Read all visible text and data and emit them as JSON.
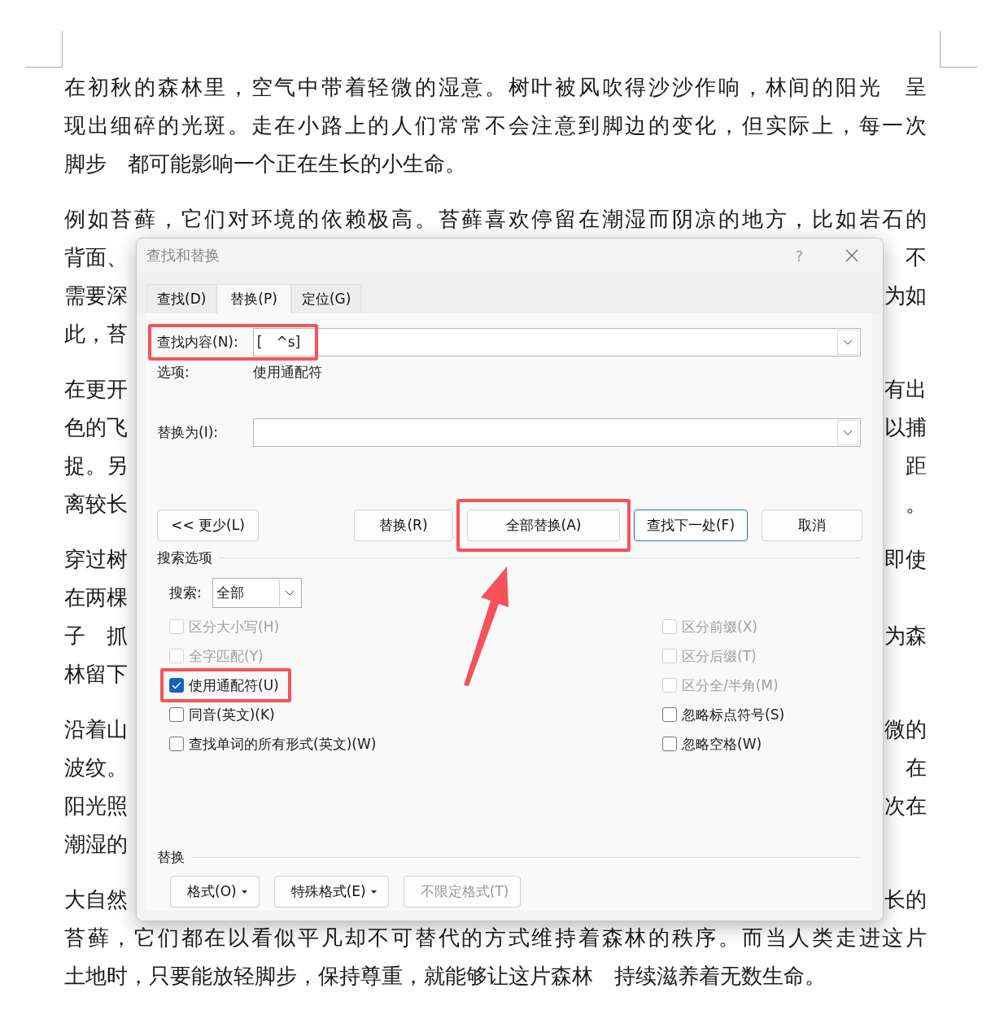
{
  "document": {
    "paragraphs": [
      {
        "lines": [
          {
            "text": "在初秋的森林里，空气中带着轻微的湿意。树叶被风吹得沙沙作响，林间的阳光　呈"
          },
          {
            "text": "现出细碎的光斑。走在小路上的人们常常不会注意到脚边的变化，但实际上，每一次"
          },
          {
            "text": "脚步　都可能影响一个正在生长的小生命。"
          }
        ]
      },
      {
        "lines": [
          {
            "text": "例如苔藓，它们对环境的依赖极高。苔藓喜欢停留在潮湿而阴凉的地方，比如岩石的"
          },
          {
            "left": "背面、",
            "right": "不"
          },
          {
            "left": "需要深",
            "right": "为如"
          },
          {
            "left": "此，苔"
          }
        ]
      },
      {
        "lines": [
          {
            "left": "在更开",
            "right": "有出"
          },
          {
            "left": "色的飞",
            "right": "以捕"
          },
          {
            "left": "捉。另",
            "right": "距"
          },
          {
            "left": "离较长",
            "right": "。"
          }
        ]
      },
      {
        "lines": [
          {
            "left": "穿过树",
            "right": "即使"
          },
          {
            "left": "在两棵"
          },
          {
            "left": "子　抓",
            "right": "为森"
          },
          {
            "left": "林留下"
          }
        ]
      },
      {
        "lines": [
          {
            "left": "沿着山",
            "right": "微的"
          },
          {
            "left": "波纹。",
            "right": "在"
          },
          {
            "left": "阳光照",
            "right": "次在"
          },
          {
            "left": "潮湿的"
          }
        ]
      },
      {
        "lines": [
          {
            "left": "大自然",
            "right": "长的"
          },
          {
            "text": "苔藓，它们都在以看似平凡却不可替代的方式维持着森林的秩序。而当人类走进这片"
          },
          {
            "text": "土地时，只要能放轻脚步，保持尊重，就能够让这片森林　持续滋养着无数生命。"
          }
        ]
      }
    ]
  },
  "dialog": {
    "title": "查找和替换",
    "help": "?",
    "tabs": [
      {
        "label": "查找(D)",
        "selected": false
      },
      {
        "label": "替换(P)",
        "selected": true
      },
      {
        "label": "定位(G)",
        "selected": false
      }
    ],
    "find": {
      "label": "查找内容(N):",
      "value": "[　^s]",
      "highlighted": true
    },
    "options": {
      "label": "选项:",
      "value": "使用通配符"
    },
    "replace": {
      "label": "替换为(I):"
    },
    "buttons": [
      {
        "label": "<< 更少(L)",
        "default": false,
        "highlighted": false
      },
      {
        "label": "替换(R)",
        "default": false,
        "highlighted": false
      },
      {
        "label": "全部替换(A)",
        "default": false,
        "highlighted": true
      },
      {
        "label": "查找下一处(F)",
        "default": true,
        "highlighted": false
      },
      {
        "label": "取消",
        "default": false,
        "highlighted": false
      }
    ],
    "search_options": {
      "title": "搜索选项",
      "search_label": "搜索:",
      "search_value": "全部",
      "left_checks": [
        {
          "label": "区分大小写(H)",
          "checked": false,
          "disabled": true,
          "highlighted": false
        },
        {
          "label": "全字匹配(Y)",
          "checked": false,
          "disabled": true,
          "highlighted": false
        },
        {
          "label": "使用通配符(U)",
          "checked": true,
          "disabled": false,
          "highlighted": true
        },
        {
          "label": "同音(英文)(K)",
          "checked": false,
          "disabled": false,
          "highlighted": false
        },
        {
          "label": "查找单词的所有形式(英文)(W)",
          "checked": false,
          "disabled": false,
          "highlighted": false
        }
      ],
      "right_checks": [
        {
          "label": "区分前缀(X)",
          "checked": false,
          "disabled": true,
          "highlighted": false
        },
        {
          "label": "区分后缀(T)",
          "checked": false,
          "disabled": true,
          "highlighted": false
        },
        {
          "label": "区分全/半角(M)",
          "checked": false,
          "disabled": true,
          "highlighted": false
        },
        {
          "label": "忽略标点符号(S)",
          "checked": false,
          "disabled": false,
          "highlighted": false
        },
        {
          "label": "忽略空格(W)",
          "checked": false,
          "disabled": false,
          "highlighted": false
        }
      ]
    },
    "replace_section": {
      "title": "替换",
      "buttons": [
        {
          "label": "格式(O)",
          "dropdown": true,
          "disabled": false
        },
        {
          "label": "特殊格式(E)",
          "dropdown": true,
          "disabled": false
        },
        {
          "label": "不限定格式(T)",
          "dropdown": false,
          "disabled": true
        }
      ]
    }
  }
}
